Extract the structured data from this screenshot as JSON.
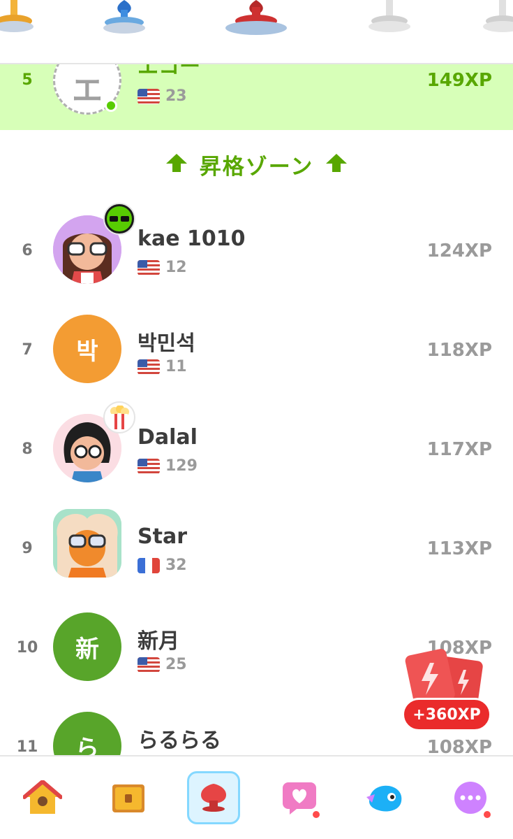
{
  "zone_label": "昇格ゾーン",
  "rows": [
    {
      "rank": "5",
      "name": "エコー",
      "streak": "23",
      "xp": "149XP",
      "flag": "us"
    },
    {
      "rank": "6",
      "name": "kae 1010",
      "streak": "12",
      "xp": "124XP",
      "flag": "us"
    },
    {
      "rank": "7",
      "name": "박민석",
      "avatar_letter": "박",
      "streak": "11",
      "xp": "118XP",
      "flag": "us"
    },
    {
      "rank": "8",
      "name": "Dalal",
      "streak": "129",
      "xp": "117XP",
      "flag": "us"
    },
    {
      "rank": "9",
      "name": "Star",
      "streak": "32",
      "xp": "113XP",
      "flag": "fr"
    },
    {
      "rank": "10",
      "name": "新月",
      "avatar_letter": "新",
      "streak": "25",
      "xp": "108XP",
      "flag": "us"
    },
    {
      "rank": "11",
      "name": "らるらる",
      "avatar_letter": "ら",
      "xp": "108XP"
    }
  ],
  "avatar_colors": {
    "orange": "#f39c33",
    "green": "#58a52a"
  },
  "xp_card": {
    "label": "+360XP"
  },
  "nav": [
    {
      "icon": "home-icon"
    },
    {
      "icon": "treasure-chest-icon"
    },
    {
      "icon": "leaderboard-shield-icon",
      "active": true
    },
    {
      "icon": "heart-message-icon",
      "notify": true
    },
    {
      "icon": "duo-bird-icon"
    },
    {
      "icon": "more-icon",
      "notify": true
    }
  ],
  "colors": {
    "accent_green": "#58a700",
    "highlight_bg": "#d7ffb8",
    "gray_text": "#9a9a9a",
    "red": "#ea2b2b"
  }
}
